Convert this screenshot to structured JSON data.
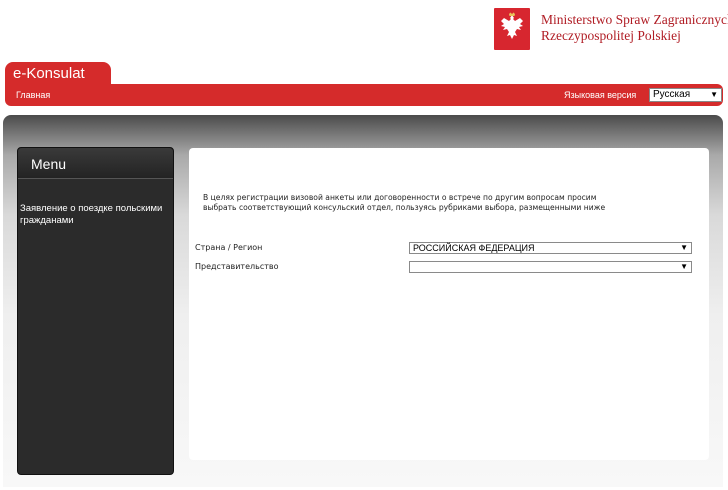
{
  "header": {
    "ministry_line1": "Ministerstwo Spraw Zagranicznych",
    "ministry_line2": "Rzeczypospolitej Polskiej",
    "emblem_icon": "polish-eagle-emblem-icon"
  },
  "brand": {
    "title": "e-Konsulat"
  },
  "nav": {
    "home": "Главная",
    "language_label": "Языковая версия",
    "language_selected": "Русская"
  },
  "menu": {
    "title": "Menu",
    "items": [
      {
        "label": "Заявление о поездке польскими гражданами"
      }
    ]
  },
  "content": {
    "intro_line1": "В целях регистрации визовой анкеты или договоренности о встрече по другим вопросам просим",
    "intro_line2": "выбрать соответствующий консульский отдел, пользуясь рубриками выбора, размещенными ниже",
    "country_label": "Страна / Регион",
    "country_value": "РОССИЙСКАЯ ФЕДЕРАЦИЯ",
    "office_label": "Представительство",
    "office_value": ""
  },
  "colors": {
    "brand_red": "#d52b2b",
    "menu_bg": "#2b2b2b"
  }
}
